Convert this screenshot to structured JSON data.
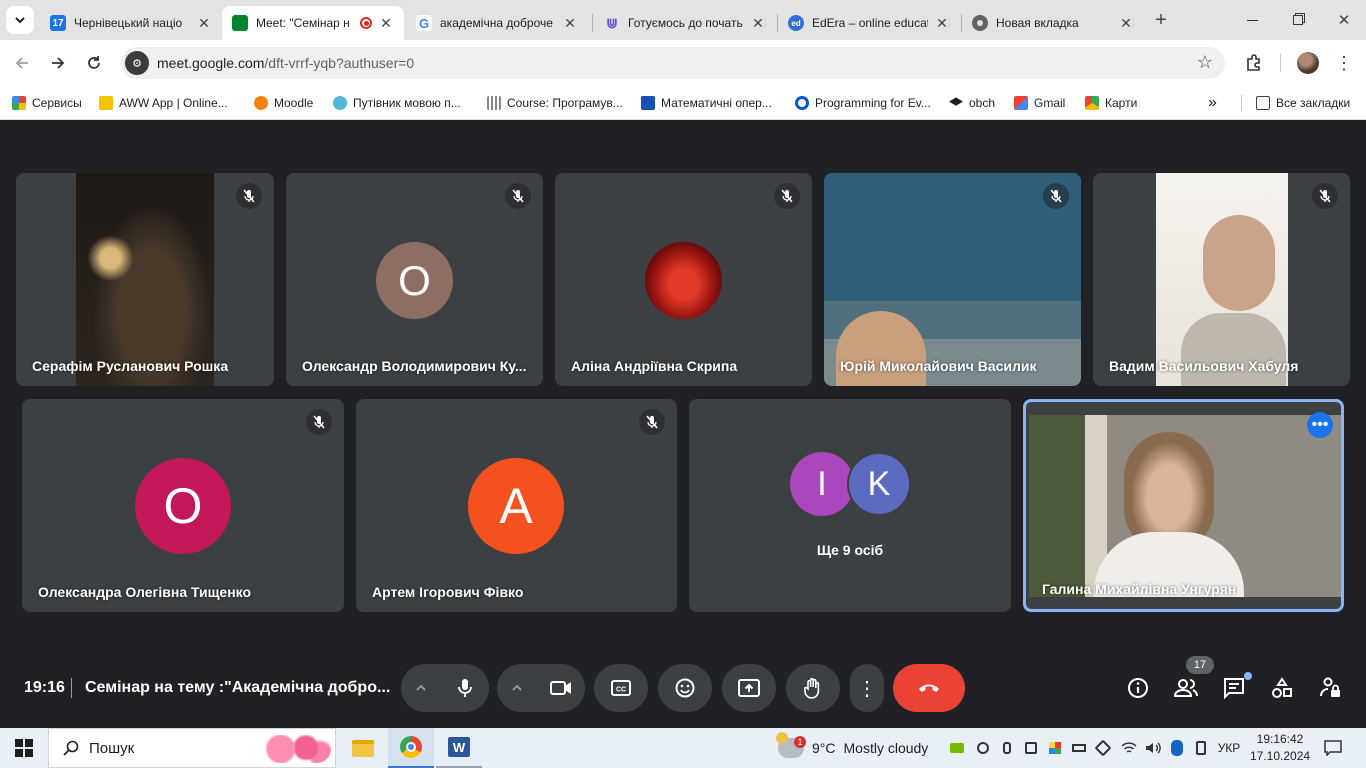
{
  "browser": {
    "tabs": [
      {
        "title": "Чернівецький націо",
        "icon": "calendar-icon",
        "color": "#1a73e8"
      },
      {
        "title": "Meet: \"Семінар н",
        "icon": "google-meet-icon",
        "color": "#00832d"
      },
      {
        "title": "академічна доброче",
        "icon": "google-icon",
        "color": "#4285f4"
      },
      {
        "title": "Готуємось до почать",
        "icon": "paperclip-icon",
        "color": "#6c4fd8"
      },
      {
        "title": "EdEra – online educat",
        "icon": "edera-icon",
        "color": "#2f6fd6"
      },
      {
        "title": "Новая вкладка",
        "icon": "chrome-icon",
        "color": "#5f6368"
      }
    ],
    "url_host": "meet.google.com",
    "url_path": "/dft-vrrf-yqb?authuser=0",
    "bookmarks": [
      {
        "label": "Сервисы",
        "icon": "apps-grid-icon"
      },
      {
        "label": "AWW App | Online...",
        "icon": "aww-app-icon"
      },
      {
        "label": "Moodle",
        "icon": "moodle-icon"
      },
      {
        "label": "Путівник мовою п...",
        "icon": "guide-icon"
      },
      {
        "label": "Course: Програмув...",
        "icon": "cisco-icon"
      },
      {
        "label": "Математичні опер...",
        "icon": "book-icon"
      },
      {
        "label": "Programming for Ev...",
        "icon": "coursera-icon"
      },
      {
        "label": "obch",
        "icon": "graduation-cap-icon"
      },
      {
        "label": "Gmail",
        "icon": "gmail-icon"
      },
      {
        "label": "Карти",
        "icon": "maps-icon"
      }
    ],
    "all_bookmarks": "Все закладки"
  },
  "meet": {
    "participants": [
      {
        "name": "Серафім Русланович Рошка",
        "type": "video"
      },
      {
        "name": "Олександр Володимирович Ку...",
        "type": "avatar",
        "initial": "O",
        "color": "#8d6e63"
      },
      {
        "name": "Аліна Андріївна Скрипа",
        "type": "photo"
      },
      {
        "name": "Юрій Миколайович Василик",
        "type": "video"
      },
      {
        "name": "Вадим Васильович Хабуля",
        "type": "video"
      },
      {
        "name": "Олександра Олегівна Тищенко",
        "type": "avatar",
        "initial": "O",
        "color": "#c2185b"
      },
      {
        "name": "Артем Ігорович Фівко",
        "type": "avatar",
        "initial": "A",
        "color": "#f4511e"
      },
      {
        "name": "Галина Михайлівна Унгурян",
        "type": "video"
      }
    ],
    "others": {
      "initials": [
        "I",
        "K"
      ],
      "colors": [
        "#ab47bc",
        "#5c6bc0"
      ],
      "label": "Ще 9 осіб"
    },
    "time": "19:16",
    "title": "Семінар на тему :\"Академічна добро...",
    "participant_count": "17"
  },
  "taskbar": {
    "search": "Пошук",
    "temperature": "9°C",
    "weather": "Mostly cloudy",
    "weather_badge": "1",
    "language": "УКР",
    "clock_time": "19:16:42",
    "clock_date": "17.10.2024"
  }
}
